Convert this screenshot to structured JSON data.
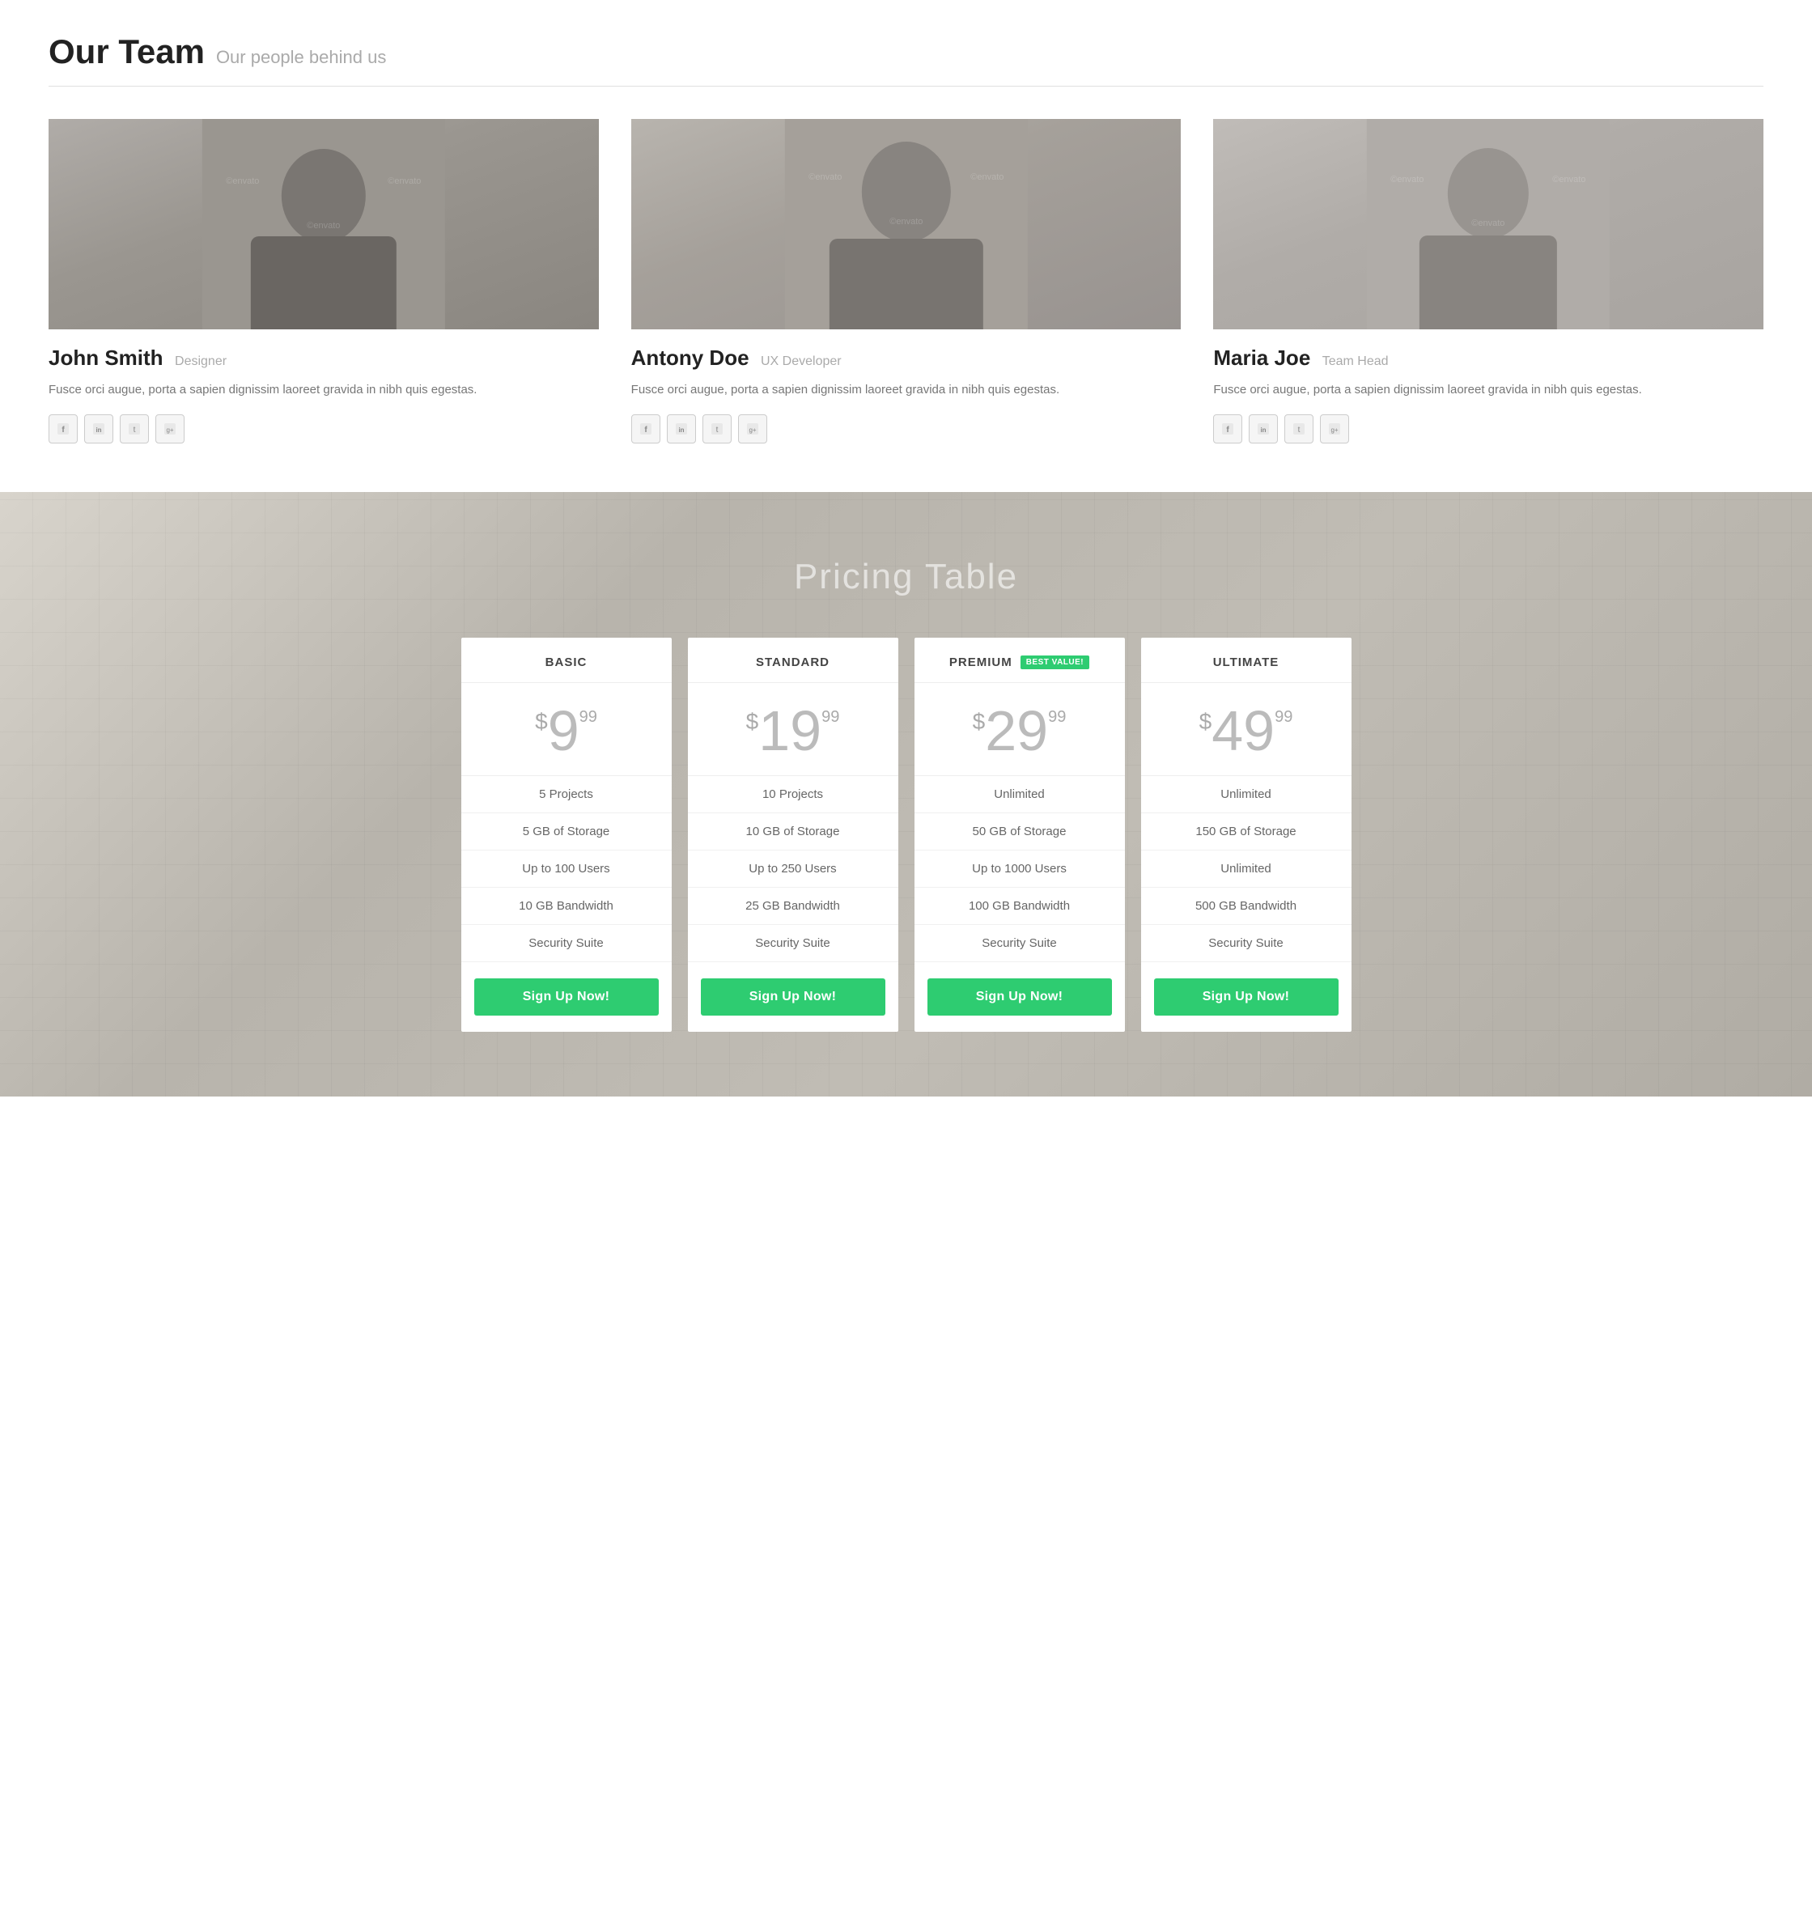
{
  "team": {
    "section_title": "Our Team",
    "section_subtitle": "Our people behind us",
    "members": [
      {
        "name": "John Smith",
        "role": "Designer",
        "bio": "Fusce orci augue, porta a sapien dignissim laoreet gravida in nibh quis egestas.",
        "person_class": "person-1",
        "socials": [
          "f",
          "in",
          "t",
          "g+"
        ]
      },
      {
        "name": "Antony Doe",
        "role": "UX Developer",
        "bio": "Fusce orci augue, porta a sapien dignissim laoreet gravida in nibh quis egestas.",
        "person_class": "person-2",
        "socials": [
          "f",
          "in",
          "t",
          "g+"
        ]
      },
      {
        "name": "Maria Joe",
        "role": "Team Head",
        "bio": "Fusce orci augue, porta a sapien dignissim laoreet gravida in nibh quis egestas.",
        "person_class": "person-3",
        "socials": [
          "f",
          "in",
          "t",
          "g+"
        ]
      }
    ]
  },
  "pricing": {
    "section_title": "Pricing Table",
    "plans": [
      {
        "name": "BASIC",
        "badge": null,
        "price_dollar": "$",
        "price_main": "9",
        "price_cents": "99",
        "features": [
          "5 Projects",
          "5 GB of Storage",
          "Up to 100 Users",
          "10 GB Bandwidth",
          "Security Suite"
        ],
        "cta": "Sign Up Now!"
      },
      {
        "name": "STANDARD",
        "badge": null,
        "price_dollar": "$",
        "price_main": "19",
        "price_cents": "99",
        "features": [
          "10 Projects",
          "10 GB of Storage",
          "Up to 250 Users",
          "25 GB Bandwidth",
          "Security Suite"
        ],
        "cta": "Sign Up Now!"
      },
      {
        "name": "PREMIUM",
        "badge": "BEST VALUE!",
        "price_dollar": "$",
        "price_main": "29",
        "price_cents": "99",
        "features": [
          "Unlimited",
          "50 GB of Storage",
          "Up to 1000 Users",
          "100 GB Bandwidth",
          "Security Suite"
        ],
        "cta": "Sign Up Now!"
      },
      {
        "name": "ULTIMATE",
        "badge": null,
        "price_dollar": "$",
        "price_main": "49",
        "price_cents": "99",
        "features": [
          "Unlimited",
          "150 GB of Storage",
          "Unlimited",
          "500 GB Bandwidth",
          "Security Suite"
        ],
        "cta": "Sign Up Now!"
      }
    ]
  },
  "social_icons": {
    "facebook": "f",
    "linkedin": "in",
    "twitter": "t",
    "google_plus": "g+"
  }
}
